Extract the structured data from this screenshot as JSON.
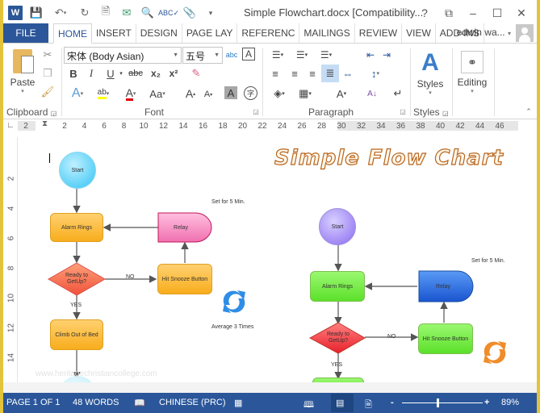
{
  "window": {
    "title": "Simple Flowchart.docx [Compatibility...",
    "controls": [
      "?",
      "⧉",
      "–",
      "☐",
      "✕"
    ]
  },
  "quick_access": [
    "word-logo",
    "save",
    "undo",
    "redo",
    "new",
    "send",
    "print-preview",
    "spelling",
    "attach",
    "customize"
  ],
  "tabs": {
    "file": "FILE",
    "items": [
      "HOME",
      "INSERT",
      "DESIGN",
      "PAGE LAY",
      "REFERENC",
      "MAILINGS",
      "REVIEW",
      "VIEW",
      "ADD-INS"
    ],
    "active": "HOME",
    "user": "edwin wa..."
  },
  "ribbon": {
    "clipboard": {
      "label": "Clipboard",
      "paste": "Paste"
    },
    "font": {
      "label": "Font",
      "font_name": "宋体 (Body Asian)",
      "font_size": "五号",
      "bold": "B",
      "italic": "I",
      "underline": "U",
      "strike": "abc",
      "sub": "x₂",
      "sup": "x²",
      "case": "Aa",
      "grow": "A",
      "shrink": "A",
      "shade": "A",
      "enclose": "字"
    },
    "paragraph": {
      "label": "Paragraph"
    },
    "styles": {
      "label": "Styles",
      "button": "Styles"
    },
    "editing": {
      "button": "Editing"
    }
  },
  "ruler": {
    "horizontal": [
      "2",
      "2",
      "4",
      "6",
      "8",
      "10",
      "12",
      "14",
      "16",
      "18",
      "20",
      "22",
      "24",
      "26",
      "28",
      "30",
      "32",
      "34",
      "36",
      "38",
      "40",
      "42",
      "44",
      "46"
    ],
    "vertical": [
      "2",
      "4",
      "6",
      "8",
      "10",
      "12",
      "14"
    ]
  },
  "document": {
    "title": "Simple Flow Chart",
    "watermark": "www.heritagechristiancollege.com",
    "flow1": {
      "start": "Start",
      "alarm": "Alarm Rings",
      "relay": "Relay",
      "decision": "Ready to GetUp?",
      "snooze": "Hit Snooze Button",
      "climb": "Climb Out of Bed",
      "no": "NO",
      "yes": "YES",
      "set_for": "Set for 5 Min.",
      "average": "Average 3 Times"
    },
    "flow2": {
      "start": "Start",
      "alarm": "Alarm Rings",
      "relay": "Relay",
      "decision": "Ready to GetUp?",
      "snooze": "Hit Snooze Button",
      "no": "NO",
      "yes": "YES",
      "set_for": "Set for 5 Min."
    }
  },
  "status": {
    "page": "PAGE 1 OF 1",
    "words": "48 WORDS",
    "language": "CHINESE (PRC)",
    "zoom": "89%",
    "zoom_minus": "-",
    "zoom_plus": "+"
  }
}
